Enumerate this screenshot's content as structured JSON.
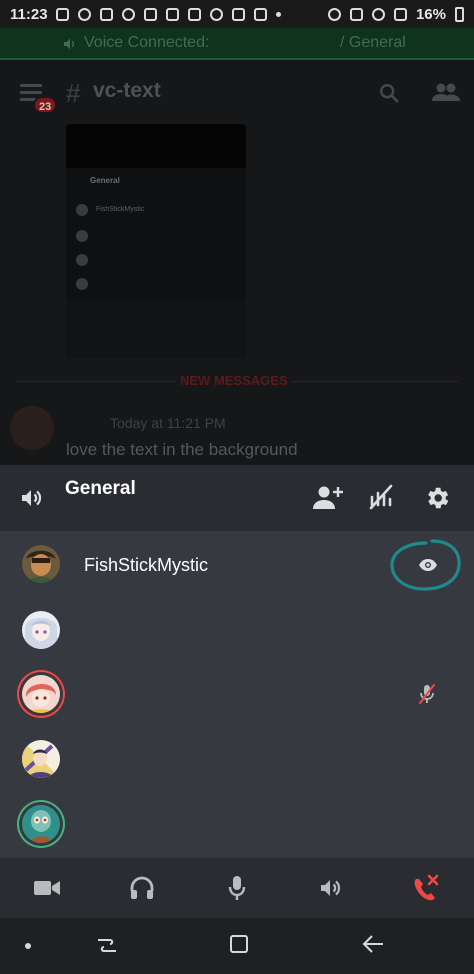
{
  "status_bar": {
    "time": "11:23",
    "battery": "16%"
  },
  "voice_banner": {
    "label": "Voice Connected:",
    "channel": "/ General"
  },
  "chat": {
    "channel_name": "vc-text",
    "unread_badge": "23",
    "screenshot_preview": {
      "channel": "General",
      "member": "FishStickMystic"
    },
    "new_messages_label": "NEW MESSAGES",
    "message_time": "Today at 11:21 PM",
    "message_text": "love the text in the background"
  },
  "voice_sheet": {
    "title": "General",
    "members": [
      {
        "name": "FishStickMystic",
        "watching": true,
        "ring": "none"
      },
      {
        "name": "",
        "ring": "none"
      },
      {
        "name": "",
        "ring": "red",
        "muted": true
      },
      {
        "name": "",
        "ring": "none"
      },
      {
        "name": "",
        "ring": "green"
      }
    ]
  },
  "colors": {
    "annotation": "#1d8a8e",
    "hangup": "#f04747",
    "sheet_bg": "#36393f",
    "header_bg": "#2a2c31"
  },
  "icons": {
    "controls": [
      "video-camera-icon",
      "headphones-icon",
      "microphone-icon",
      "speaker-icon",
      "hang-up-icon"
    ],
    "navigation": [
      "nav-dot-icon",
      "recent-apps-icon",
      "home-icon",
      "back-icon"
    ]
  }
}
